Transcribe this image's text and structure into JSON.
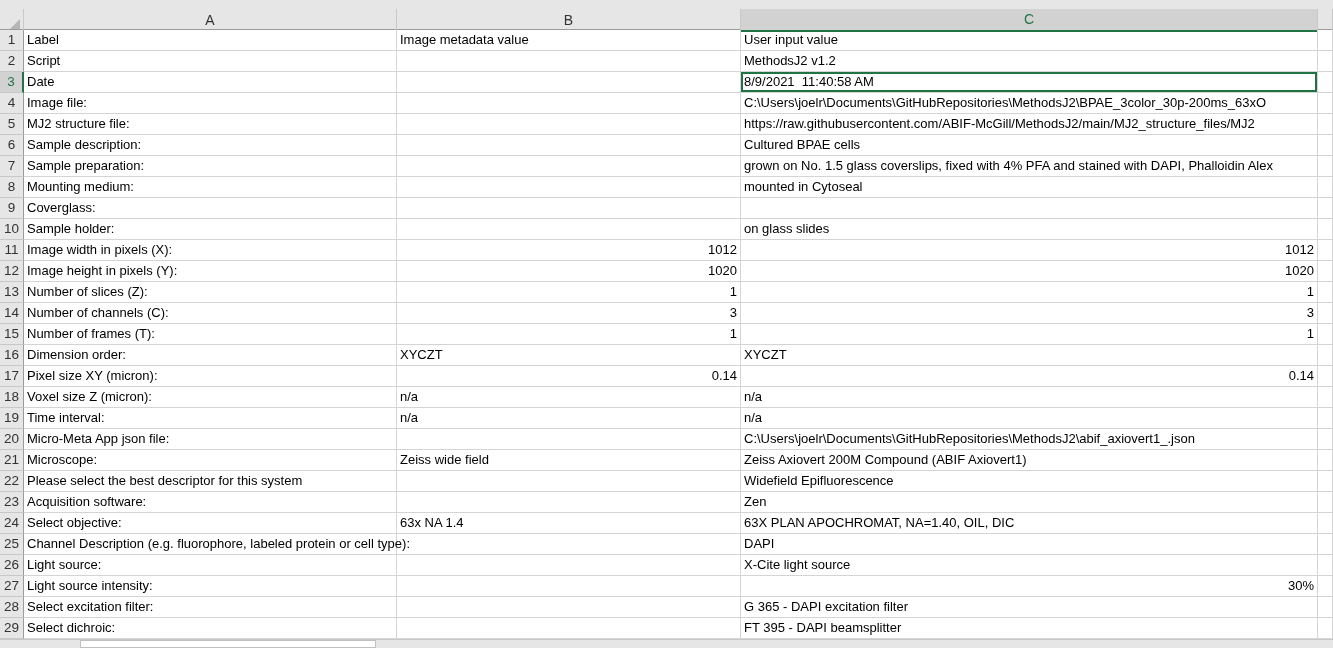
{
  "columns": [
    {
      "label": "A",
      "selected": false
    },
    {
      "label": "B",
      "selected": false
    },
    {
      "label": "C",
      "selected": true
    }
  ],
  "rows": [
    {
      "number": "1",
      "selected": false,
      "a": {
        "text": "Label"
      },
      "b": {
        "text": "Image metadata value"
      },
      "c": {
        "text": "User input value"
      }
    },
    {
      "number": "2",
      "selected": false,
      "a": {
        "text": "Script"
      },
      "c": {
        "text": "MethodsJ2 v1.2"
      }
    },
    {
      "number": "3",
      "selected": true,
      "a": {
        "text": "Date"
      },
      "c": {
        "text": "8/9/2021  11:40:58 AM",
        "selected": true
      }
    },
    {
      "number": "4",
      "selected": false,
      "a": {
        "text": "Image file:"
      },
      "c": {
        "text": "C:\\Users\\joelr\\Documents\\GitHubRepositories\\MethodsJ2\\BPAE_3color_30p-200ms_63xO"
      }
    },
    {
      "number": "5",
      "selected": false,
      "a": {
        "text": "MJ2 structure file:"
      },
      "c": {
        "text": "https://raw.githubusercontent.com/ABIF-McGill/MethodsJ2/main/MJ2_structure_files/MJ2"
      }
    },
    {
      "number": "6",
      "selected": false,
      "a": {
        "text": "Sample description:"
      },
      "c": {
        "text": "Cultured BPAE cells"
      }
    },
    {
      "number": "7",
      "selected": false,
      "a": {
        "text": "Sample preparation:"
      },
      "c": {
        "text": "grown on No. 1.5 glass coverslips, fixed with 4% PFA and stained with DAPI, Phalloidin Alex"
      }
    },
    {
      "number": "8",
      "selected": false,
      "a": {
        "text": "Mounting medium:"
      },
      "c": {
        "text": "mounted in Cytoseal"
      }
    },
    {
      "number": "9",
      "selected": false,
      "a": {
        "text": "Coverglass:"
      }
    },
    {
      "number": "10",
      "selected": false,
      "a": {
        "text": "Sample holder:"
      },
      "c": {
        "text": "on glass slides"
      }
    },
    {
      "number": "11",
      "selected": false,
      "a": {
        "text": "Image width in pixels (X):"
      },
      "b": {
        "text": "1012",
        "kind": "number"
      },
      "c": {
        "text": "1012",
        "kind": "number"
      }
    },
    {
      "number": "12",
      "selected": false,
      "a": {
        "text": "Image height in pixels (Y):"
      },
      "b": {
        "text": "1020",
        "kind": "number"
      },
      "c": {
        "text": "1020",
        "kind": "number"
      }
    },
    {
      "number": "13",
      "selected": false,
      "a": {
        "text": "Number of slices (Z):"
      },
      "b": {
        "text": "1",
        "kind": "number"
      },
      "c": {
        "text": "1",
        "kind": "number"
      }
    },
    {
      "number": "14",
      "selected": false,
      "a": {
        "text": "Number of channels (C):"
      },
      "b": {
        "text": "3",
        "kind": "number"
      },
      "c": {
        "text": "3",
        "kind": "number"
      }
    },
    {
      "number": "15",
      "selected": false,
      "a": {
        "text": "Number of frames (T):"
      },
      "b": {
        "text": "1",
        "kind": "number"
      },
      "c": {
        "text": "1",
        "kind": "number"
      }
    },
    {
      "number": "16",
      "selected": false,
      "a": {
        "text": "Dimension order:"
      },
      "b": {
        "text": "XYCZT"
      },
      "c": {
        "text": "XYCZT"
      }
    },
    {
      "number": "17",
      "selected": false,
      "a": {
        "text": "Pixel size XY (micron):"
      },
      "b": {
        "text": "0.14",
        "kind": "number"
      },
      "c": {
        "text": "0.14",
        "kind": "number"
      }
    },
    {
      "number": "18",
      "selected": false,
      "a": {
        "text": "Voxel size Z (micron):"
      },
      "b": {
        "text": "n/a"
      },
      "c": {
        "text": "n/a"
      }
    },
    {
      "number": "19",
      "selected": false,
      "a": {
        "text": "Time interval:"
      },
      "b": {
        "text": "n/a"
      },
      "c": {
        "text": "n/a"
      }
    },
    {
      "number": "20",
      "selected": false,
      "a": {
        "text": "Micro-Meta App json file:"
      },
      "c": {
        "text": "C:\\Users\\joelr\\Documents\\GitHubRepositories\\MethodsJ2\\abif_axiovert1_.json"
      }
    },
    {
      "number": "21",
      "selected": false,
      "a": {
        "text": "Microscope:"
      },
      "b": {
        "text": "Zeiss wide field"
      },
      "c": {
        "text": "Zeiss Axiovert 200M Compound (ABIF Axiovert1)"
      }
    },
    {
      "number": "22",
      "selected": false,
      "a": {
        "text": "Please select the best descriptor for this system"
      },
      "c": {
        "text": "Widefield Epifluorescence"
      }
    },
    {
      "number": "23",
      "selected": false,
      "a": {
        "text": "Acquisition software:"
      },
      "c": {
        "text": "Zen"
      }
    },
    {
      "number": "24",
      "selected": false,
      "a": {
        "text": "Select objective:"
      },
      "b": {
        "text": "63x NA 1.4"
      },
      "c": {
        "text": "63X PLAN APOCHROMAT, NA=1.40, OIL, DIC"
      }
    },
    {
      "number": "25",
      "selected": false,
      "a": {
        "text": "Channel Description (e.g. fluorophore, labeled protein or cell type):"
      },
      "c": {
        "text": "DAPI"
      }
    },
    {
      "number": "26",
      "selected": false,
      "a": {
        "text": "Light source:"
      },
      "c": {
        "text": "X-Cite light source"
      }
    },
    {
      "number": "27",
      "selected": false,
      "a": {
        "text": "Light source intensity:"
      },
      "c": {
        "text": "30%",
        "kind": "number"
      }
    },
    {
      "number": "28",
      "selected": false,
      "a": {
        "text": "Select excitation filter:"
      },
      "c": {
        "text": "G 365 - DAPI excitation filter"
      }
    },
    {
      "number": "29",
      "selected": false,
      "a": {
        "text": "Select dichroic:"
      },
      "c": {
        "text": "FT 395 - DAPI beamsplitter"
      }
    }
  ]
}
